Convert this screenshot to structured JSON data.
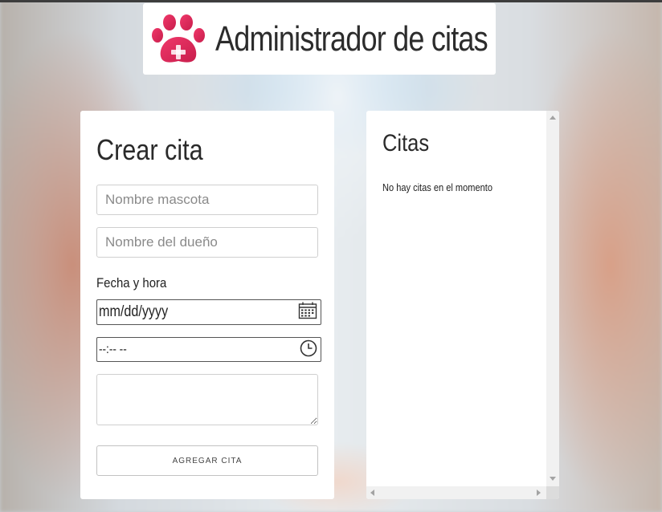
{
  "header": {
    "title": "Administrador de citas",
    "logo_icon": "paw-plus-icon",
    "logo_color": "#e8285a"
  },
  "form": {
    "title": "Crear cita",
    "pet_name_placeholder": "Nombre mascota",
    "owner_name_placeholder": "Nombre del dueño",
    "datetime_label": "Fecha y hora",
    "date_value": "mm/dd/yyyy",
    "time_value": "--:-- --",
    "date_icon": "calendar-icon",
    "time_icon": "clock-icon",
    "submit_label": "AGREGAR CITA"
  },
  "appointments": {
    "title": "Citas",
    "empty_message": "No hay citas en el momento"
  }
}
